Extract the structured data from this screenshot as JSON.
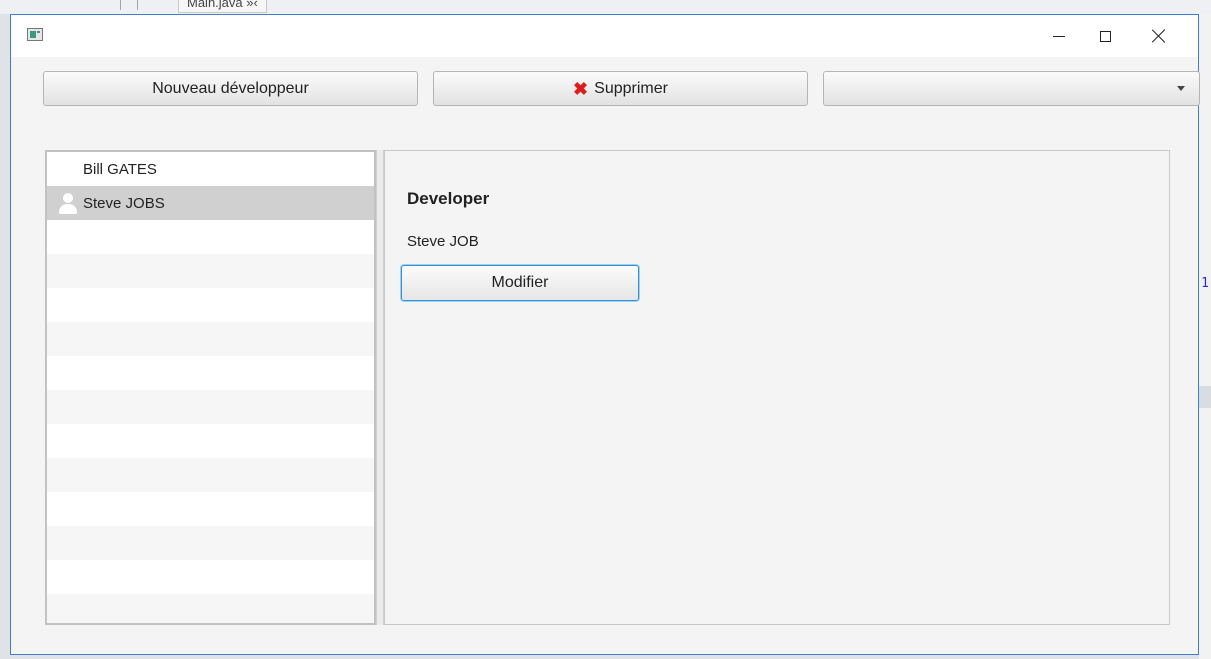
{
  "background": {
    "ide_tab_label": "Main.java",
    "ide_tab_suffix": "»‹",
    "right_edge_char": "1"
  },
  "window": {
    "title": "",
    "icon": "app-icon",
    "controls": {
      "minimize_icon": "minimize-icon",
      "maximize_icon": "maximize-icon",
      "close_icon": "close-icon"
    }
  },
  "toolbar": {
    "new_label": "Nouveau développeur",
    "delete_label": "Supprimer",
    "delete_icon": "red-x-icon",
    "combo_value": ""
  },
  "developers": {
    "items": [
      {
        "label": "Bill GATES",
        "selected": false,
        "icon": ""
      },
      {
        "label": "Steve JOBS",
        "selected": true,
        "icon": "user-icon"
      }
    ]
  },
  "detail": {
    "heading": "Developer",
    "name": "Steve JOB",
    "modify_label": "Modifier"
  },
  "colors": {
    "accent": "#3a7fd5",
    "delete_icon": "#e01b1b",
    "selected_row": "#d0d0d0"
  }
}
